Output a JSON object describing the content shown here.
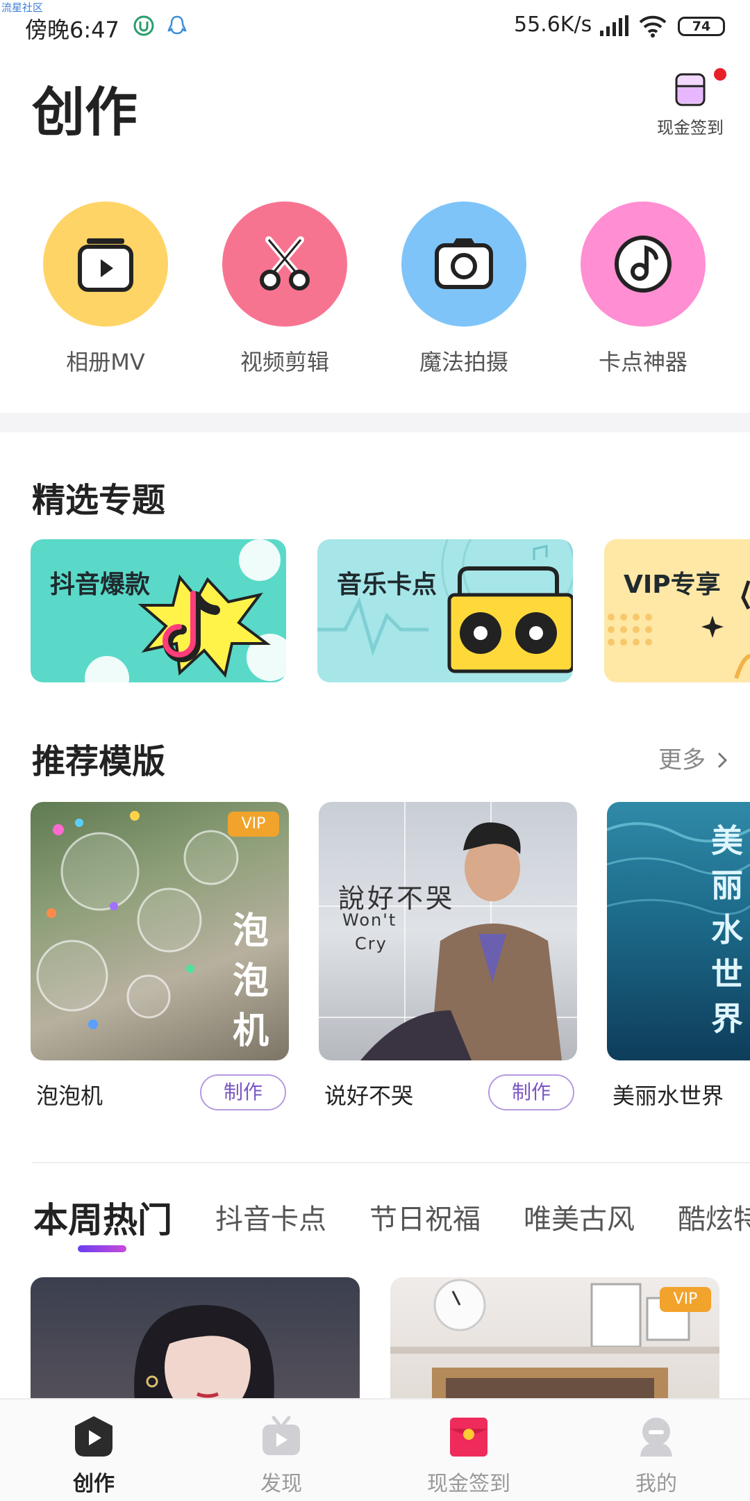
{
  "status_bar": {
    "watermark": "流星社区",
    "time": "傍晚6:47",
    "net_speed": "55.6K/s",
    "battery": "74"
  },
  "header": {
    "title": "创作",
    "checkin_label": "现金签到"
  },
  "tools": [
    {
      "label": "相册MV",
      "icon": "album-play-icon",
      "color": "#ffd466"
    },
    {
      "label": "视频剪辑",
      "icon": "scissors-icon",
      "color": "#f77490"
    },
    {
      "label": "魔法拍摄",
      "icon": "camera-icon",
      "color": "#7ec4f8"
    },
    {
      "label": "卡点神器",
      "icon": "music-disc-icon",
      "color": "#ff8ed2"
    }
  ],
  "featured": {
    "title": "精选专题",
    "items": [
      {
        "label": "抖音爆款",
        "color": "#5ad9c8"
      },
      {
        "label": "音乐卡点",
        "color": "#a6e6e8"
      },
      {
        "label": "VIP专享",
        "color": "#ffe7a6"
      }
    ]
  },
  "recommended": {
    "title": "推荐模版",
    "more": "更多",
    "items": [
      {
        "name": "泡泡机",
        "vip": "VIP",
        "button": "制作",
        "overlay": "泡泡机"
      },
      {
        "name": "说好不哭",
        "button": "制作",
        "overlay_cn": "說好不哭",
        "overlay_en1": "Won't",
        "overlay_en2": "Cry"
      },
      {
        "name": "美丽水世界",
        "overlay": "美丽水世界"
      }
    ]
  },
  "tabs": {
    "items": [
      "本周热门",
      "抖音卡点",
      "节日祝福",
      "唯美古风",
      "酷炫特"
    ],
    "active": 0
  },
  "hot": {
    "items": [
      {
        "vip": ""
      },
      {
        "vip": "VIP"
      }
    ]
  },
  "bottom_nav": {
    "items": [
      {
        "label": "创作",
        "icon": "create-icon"
      },
      {
        "label": "发现",
        "icon": "tv-icon"
      },
      {
        "label": "现金签到",
        "icon": "red-envelope-icon"
      },
      {
        "label": "我的",
        "icon": "profile-icon"
      }
    ],
    "active": 0
  },
  "colors": {
    "accent_purple": "#7b55c4",
    "vip_orange": "#f2a32c",
    "notification_red": "#e8202a"
  }
}
